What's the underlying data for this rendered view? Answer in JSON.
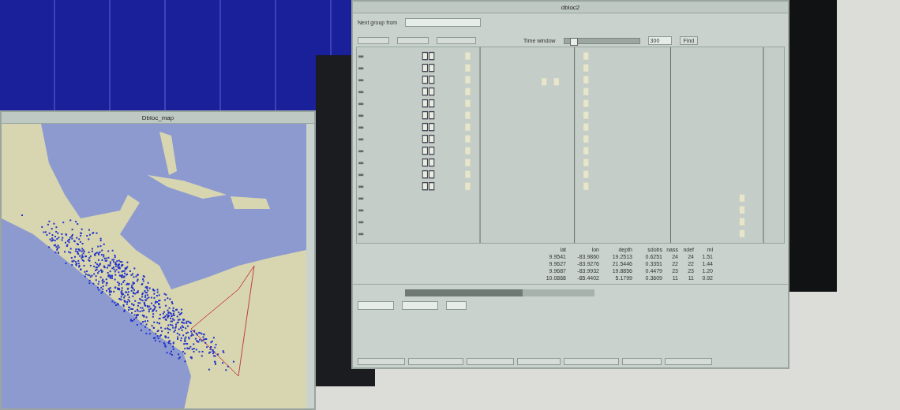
{
  "map_window": {
    "title": "Dbloc_map"
  },
  "main_window": {
    "title": "dbloc2",
    "next_group_label": "Next group from",
    "time_window_label": "Time window",
    "time_window_value": "300",
    "time_window_slider": {
      "level": 0.12
    },
    "find_button": "Find",
    "progress": {
      "level": 0.62
    }
  },
  "table": {
    "columns": [
      "lat",
      "lon",
      "depth",
      "sdobs",
      "nass",
      "ndef",
      "ml"
    ],
    "rows": [
      {
        "cells": [
          "9.9541",
          "-83.9860",
          "19.2513",
          "0.6251",
          "24",
          "24",
          "1.51"
        ]
      },
      {
        "cells": [
          "9.9627",
          "-83.9276",
          "21.5446",
          "0.3351",
          "22",
          "22",
          "1.44"
        ]
      },
      {
        "cells": [
          "9.9687",
          "-83.9932",
          "19.8856",
          "0.4479",
          "23",
          "23",
          "1.20"
        ]
      },
      {
        "cells": [
          "10.0868",
          "-85.4402",
          "5.1799",
          "0.3609",
          "11",
          "11",
          "0.92"
        ]
      }
    ]
  }
}
